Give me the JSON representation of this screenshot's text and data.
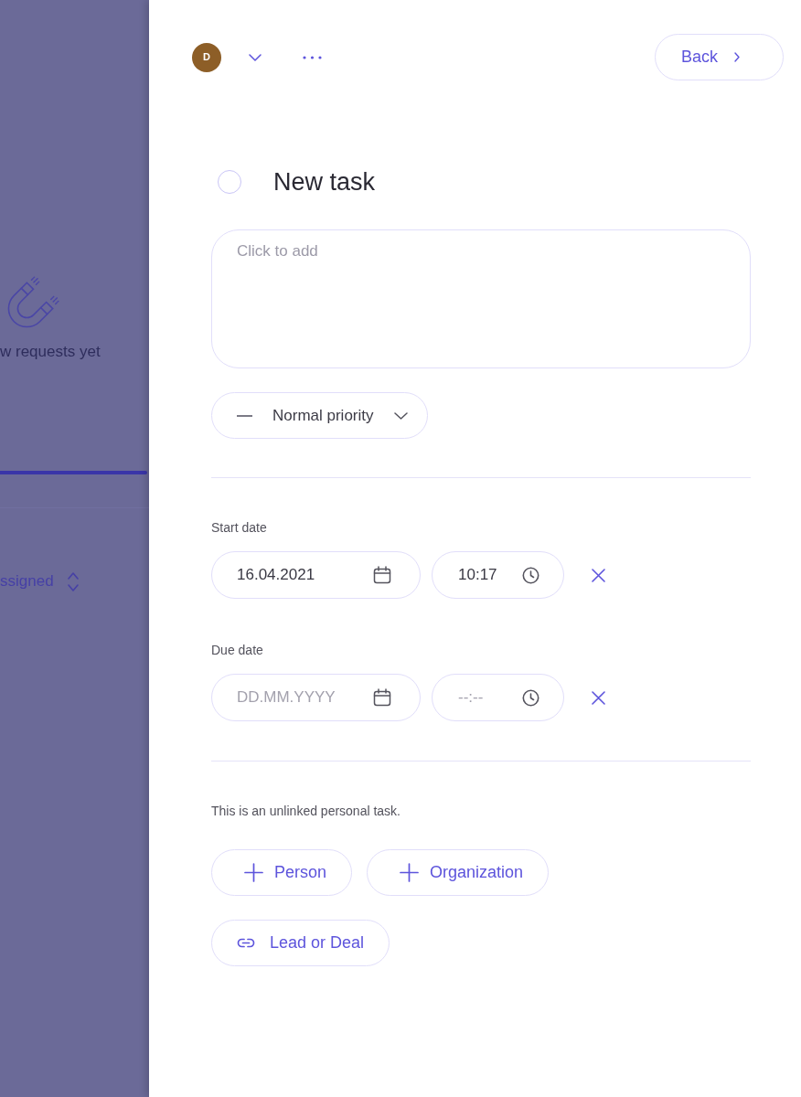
{
  "background_page": {
    "empty_state": {
      "message": "w requests yet"
    },
    "filter": {
      "label": "ssigned"
    }
  },
  "header": {
    "avatar": {
      "initial": "D"
    },
    "back_button": {
      "label": "Back"
    }
  },
  "task": {
    "completed": false,
    "title": "New task",
    "description": {
      "placeholder": "Click to add"
    },
    "priority": {
      "label": "Normal priority"
    }
  },
  "start_date": {
    "label": "Start date",
    "date": {
      "value": "16.04.2021"
    },
    "time": {
      "value": "10:17"
    }
  },
  "due_date": {
    "label": "Due date",
    "date": {
      "placeholder": "DD.MM.YYYY"
    },
    "time": {
      "placeholder": "--:--"
    }
  },
  "links": {
    "note": "This is an unlinked personal task.",
    "buttons": [
      {
        "kind": "add",
        "label": "Person"
      },
      {
        "kind": "add",
        "label": "Organization"
      },
      {
        "kind": "link",
        "label": "Lead or Deal"
      }
    ]
  }
}
